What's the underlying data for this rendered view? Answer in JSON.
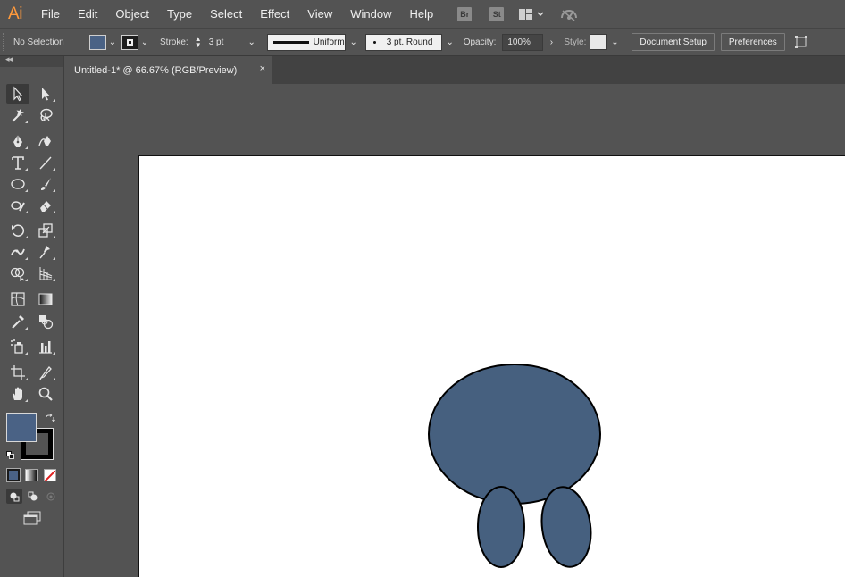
{
  "app": {
    "logo": "Ai",
    "menu": [
      "File",
      "Edit",
      "Object",
      "Type",
      "Select",
      "Effect",
      "View",
      "Window",
      "Help"
    ],
    "badges": [
      "Br",
      "St"
    ]
  },
  "control_bar": {
    "selection_label": "No Selection",
    "stroke_label": "Stroke:",
    "stroke_value": "3 pt",
    "profile_label": "Uniform",
    "brush_label": "3 pt. Round",
    "opacity_label": "Opacity:",
    "opacity_value": "100%",
    "style_label": "Style:",
    "document_setup": "Document Setup",
    "preferences": "Preferences",
    "fill_color": "#4a6285",
    "stroke_color": "#1e1e1e"
  },
  "document": {
    "tab_title": "Untitled-1* @ 66.67% (RGB/Preview)",
    "close_glyph": "×"
  },
  "toolbar": {
    "collapse_glyph": "◂◂",
    "tools": [
      "selection-tool",
      "direct-selection-tool",
      "magic-wand-tool",
      "lasso-tool",
      "pen-tool",
      "curvature-tool",
      "type-tool",
      "line-segment-tool",
      "ellipse-tool",
      "paintbrush-tool",
      "shaper-tool",
      "eraser-tool",
      "rotate-tool",
      "scale-tool",
      "width-tool",
      "puppet-warp-tool",
      "shape-builder-tool",
      "perspective-grid-tool",
      "mesh-tool",
      "gradient-tool",
      "eyedropper-tool",
      "blend-tool",
      "symbol-sprayer-tool",
      "column-graph-tool",
      "artboard-tool",
      "slice-tool",
      "hand-tool",
      "zoom-tool"
    ],
    "fill_swatch_color": "#4a6285",
    "stroke_swatch_color": "#000000"
  },
  "artwork": {
    "fill": "#46607f",
    "stroke": "#000000",
    "shapes": [
      "head-ellipse",
      "left-foot-ellipse",
      "right-foot-ellipse"
    ]
  }
}
